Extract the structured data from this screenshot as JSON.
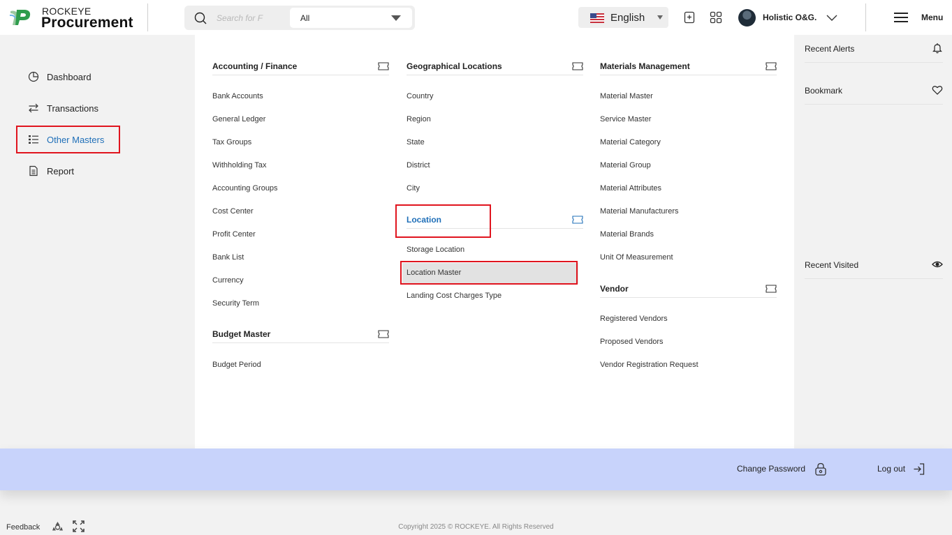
{
  "header": {
    "brand_top": "ROCKEYE",
    "brand_main": "Procurement",
    "search_placeholder": "Search for F",
    "scope_value": "All",
    "language": "English",
    "user_name": "Holistic O&G.",
    "menu_label": "Menu"
  },
  "nav": {
    "items": [
      {
        "label": "Dashboard",
        "icon": "pie-chart-icon",
        "active": false
      },
      {
        "label": "Transactions",
        "icon": "transfer-arrows-icon",
        "active": false
      },
      {
        "label": "Other Masters",
        "icon": "list-icon",
        "active": true
      },
      {
        "label": "Report",
        "icon": "document-icon",
        "active": false
      }
    ]
  },
  "megamenu": {
    "accounting": {
      "title": "Accounting / Finance",
      "links": [
        "Bank Accounts",
        "General Ledger",
        "Tax Groups",
        "Withholding Tax",
        "Accounting Groups",
        "Cost Center",
        "Profit Center",
        "Bank List",
        "Currency",
        "Security Term"
      ]
    },
    "budget": {
      "title": "Budget Master",
      "links": [
        "Budget Period"
      ]
    },
    "geo": {
      "title": "Geographical Locations",
      "links": [
        "Country",
        "Region",
        "State",
        "District",
        "City"
      ]
    },
    "location": {
      "title": "Location",
      "links": [
        "Storage Location",
        "Location Master",
        "Landing Cost Charges Type"
      ],
      "selected": "Location Master"
    },
    "materials": {
      "title": "Materials Management",
      "links": [
        "Material Master",
        "Service Master",
        "Material Category",
        "Material Group",
        "Material Attributes",
        "Material Manufacturers",
        "Material Brands",
        "Unit Of Measurement"
      ]
    },
    "vendor": {
      "title": "Vendor",
      "links": [
        "Registered Vendors",
        "Proposed Vendors",
        "Vendor Registration Request"
      ]
    }
  },
  "side_panel": {
    "recent_alerts": "Recent Alerts",
    "bookmark": "Bookmark",
    "recent_visited": "Recent Visited"
  },
  "account_bar": {
    "change_password": "Change Password",
    "logout": "Log out"
  },
  "footer": {
    "feedback": "Feedback",
    "copyright": "Copyright 2025 © ROCKEYE. All Rights Reserved"
  },
  "colors": {
    "accent": "#1f6fb8",
    "highlight": "#e0141e",
    "account_bar": "#c8d3fb"
  }
}
